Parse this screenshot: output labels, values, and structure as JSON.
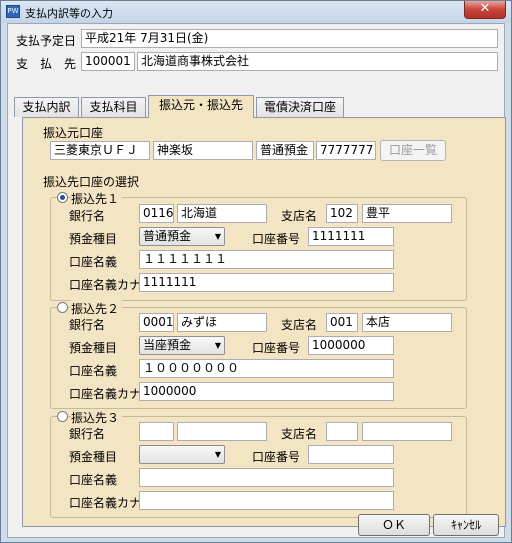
{
  "window": {
    "icon_text": "PW",
    "title": "支払内訳等の入力",
    "close_glyph": "✕"
  },
  "header": {
    "due_date_label": "支払予定日",
    "due_date_value": "平成21年 7月31日(金)",
    "payee_label": "支　払　先",
    "payee_code": "100001",
    "payee_name": "北海道商事株式会社"
  },
  "tabs": [
    {
      "label": "支払内訳",
      "active": false
    },
    {
      "label": "支払科目",
      "active": false
    },
    {
      "label": "振込元・振込先",
      "active": true
    },
    {
      "label": "電債決済口座",
      "active": false
    }
  ],
  "source": {
    "title": "振込元口座",
    "bank": "三菱東京ＵＦＪ",
    "branch": "神楽坂",
    "type": "普通預金",
    "account": "7777777",
    "list_button": "口座一覧"
  },
  "dest_title": "振込先口座の選択",
  "destinations": [
    {
      "label": "振込先１",
      "selected": true,
      "bank_label": "銀行名",
      "bank_code": "0116",
      "bank_name": "北海道",
      "branch_label": "支店名",
      "branch_code": "102",
      "branch_name": "豊平",
      "type_label": "預金種目",
      "type_value": "普通預金",
      "account_label": "口座番号",
      "account_value": "1111111",
      "holder_label": "口座名義",
      "holder_value": "１１１１１１１",
      "kana_label": "口座名義カナ",
      "kana_value": "1111111"
    },
    {
      "label": "振込先２",
      "selected": false,
      "bank_label": "銀行名",
      "bank_code": "0001",
      "bank_name": "みずほ",
      "branch_label": "支店名",
      "branch_code": "001",
      "branch_name": "本店",
      "type_label": "預金種目",
      "type_value": "当座預金",
      "account_label": "口座番号",
      "account_value": "1000000",
      "holder_label": "口座名義",
      "holder_value": "１０００００００",
      "kana_label": "口座名義カナ",
      "kana_value": "1000000"
    },
    {
      "label": "振込先３",
      "selected": false,
      "bank_label": "銀行名",
      "bank_code": "",
      "bank_name": "",
      "branch_label": "支店名",
      "branch_code": "",
      "branch_name": "",
      "type_label": "預金種目",
      "type_value": "",
      "account_label": "口座番号",
      "account_value": "",
      "holder_label": "口座名義",
      "holder_value": "",
      "kana_label": "口座名義カナ",
      "kana_value": ""
    }
  ],
  "buttons": {
    "ok": "ＯＫ",
    "cancel": "ｷｬﾝｾﾙ"
  },
  "icons": {
    "dropdown": "▼"
  }
}
